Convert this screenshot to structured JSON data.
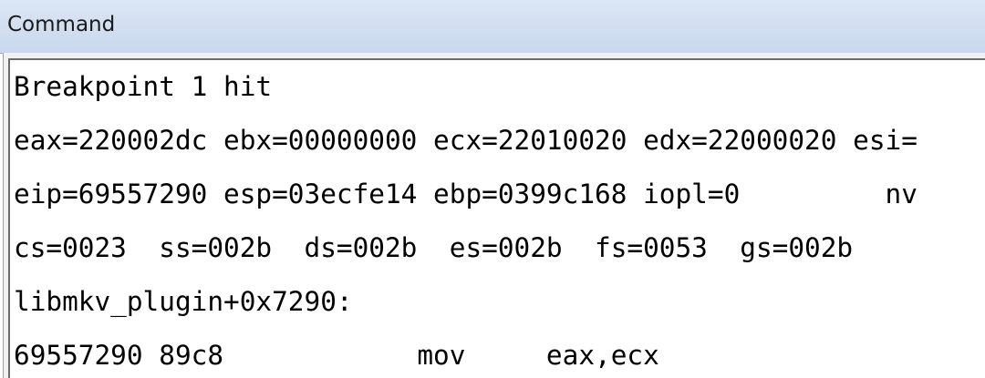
{
  "window": {
    "title": "Command"
  },
  "output": {
    "lines": [
      "Breakpoint 1 hit",
      "eax=220002dc ebx=00000000 ecx=22010020 edx=22000020 esi=",
      "eip=69557290 esp=03ecfe14 ebp=0399c168 iopl=0         nv",
      "cs=0023  ss=002b  ds=002b  es=002b  fs=0053  gs=002b   ",
      "libmkv_plugin+0x7290:",
      "69557290 89c8            mov     eax,ecx"
    ]
  }
}
